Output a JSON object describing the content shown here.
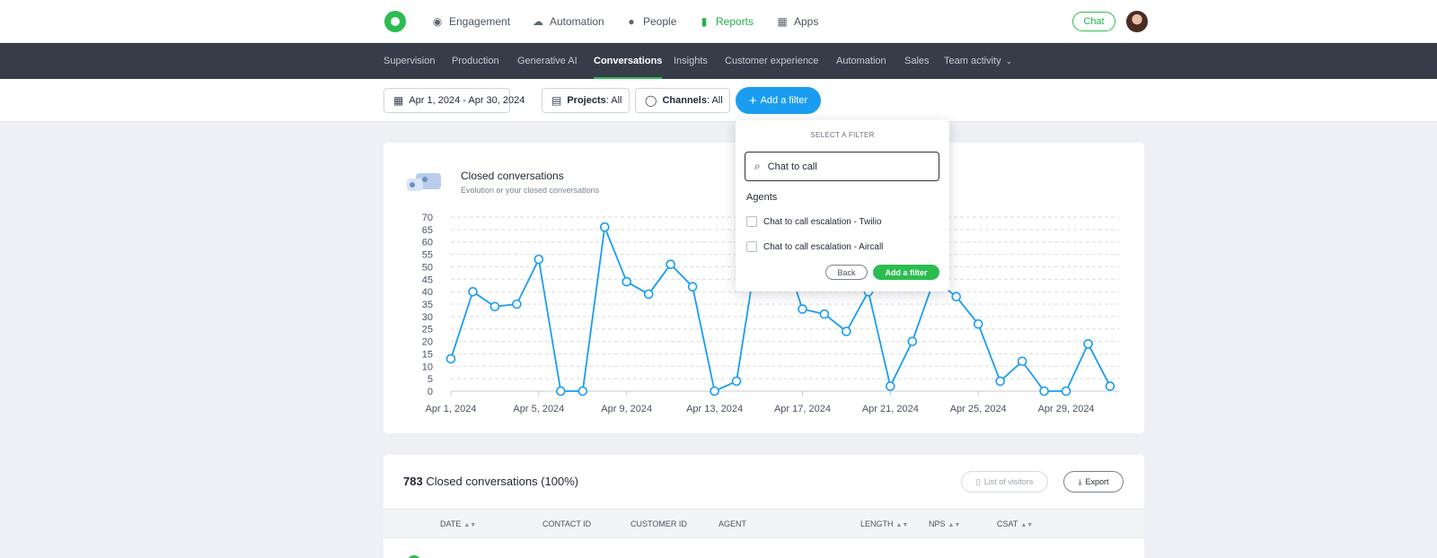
{
  "topnav": {
    "items": [
      {
        "label": "Engagement",
        "icon": "engagement-icon",
        "active": false
      },
      {
        "label": "Automation",
        "icon": "automation-icon",
        "active": false
      },
      {
        "label": "People",
        "icon": "person-icon",
        "active": false
      },
      {
        "label": "Reports",
        "icon": "bar-chart-icon",
        "active": true
      },
      {
        "label": "Apps",
        "icon": "apps-grid-icon",
        "active": false
      }
    ],
    "chat_label": "Chat",
    "accent": "#2bbd4f"
  },
  "subnav": {
    "items": [
      {
        "label": "Supervision"
      },
      {
        "label": "Production"
      },
      {
        "label": "Generative AI"
      },
      {
        "label": "Conversations",
        "active": true
      },
      {
        "label": "Insights"
      },
      {
        "label": "Customer experience"
      },
      {
        "label": "Automation"
      },
      {
        "label": "Sales"
      },
      {
        "label": "Team activity"
      }
    ]
  },
  "filters": {
    "date_range": "Apr 1, 2024 - Apr 30, 2024",
    "projects_label": "Projects",
    "projects_value": ": All",
    "channels_label": "Channels",
    "channels_value": ": All",
    "add_filter_label": "Add a filter"
  },
  "popover": {
    "title": "SELECT A FILTER",
    "search_value": "Chat to call",
    "section": "Agents",
    "options": [
      "Chat to call escalation - Twilio",
      "Chat to call escalation - Aircall"
    ],
    "back_label": "Back",
    "add_label": "Add a filter"
  },
  "chart_card": {
    "title": "Closed conversations",
    "subtitle": "Evolution or your closed conversations"
  },
  "chart_data": {
    "type": "line",
    "x": [
      "Apr 1, 2024",
      "Apr 2, 2024",
      "Apr 3, 2024",
      "Apr 4, 2024",
      "Apr 5, 2024",
      "Apr 6, 2024",
      "Apr 7, 2024",
      "Apr 8, 2024",
      "Apr 9, 2024",
      "Apr 10, 2024",
      "Apr 11, 2024",
      "Apr 12, 2024",
      "Apr 13, 2024",
      "Apr 14, 2024",
      "Apr 15, 2024",
      "Apr 16, 2024",
      "Apr 17, 2024",
      "Apr 18, 2024",
      "Apr 19, 2024",
      "Apr 20, 2024",
      "Apr 21, 2024",
      "Apr 22, 2024",
      "Apr 23, 2024",
      "Apr 24, 2024",
      "Apr 25, 2024",
      "Apr 26, 2024",
      "Apr 27, 2024",
      "Apr 28, 2024",
      "Apr 29, 2024",
      "Apr 30, 2024"
    ],
    "values": [
      13,
      40,
      34,
      35,
      53,
      0,
      0,
      66,
      44,
      39,
      51,
      42,
      0,
      4,
      60,
      60,
      33,
      31,
      24,
      40,
      2,
      20,
      45,
      38,
      27,
      4,
      12,
      0,
      0,
      19,
      2
    ],
    "x_ticks": [
      "Apr 1, 2024",
      "Apr 5, 2024",
      "Apr 9, 2024",
      "Apr 13, 2024",
      "Apr 17, 2024",
      "Apr 21, 2024",
      "Apr 25, 2024",
      "Apr 29, 2024"
    ],
    "y_ticks": [
      0,
      5,
      10,
      15,
      20,
      25,
      30,
      35,
      40,
      45,
      50,
      55,
      60,
      65,
      70
    ],
    "ylim": [
      0,
      70
    ],
    "grid": true,
    "color": "#1a9df0"
  },
  "table": {
    "count": "783",
    "title_rest": " Closed conversations (100%)",
    "list_visitors_label": "List of visitors",
    "export_label": "Export",
    "columns": [
      "DATE",
      "CONTACT ID",
      "CUSTOMER ID",
      "AGENT",
      "LENGTH",
      "NPS",
      "CSAT"
    ]
  }
}
